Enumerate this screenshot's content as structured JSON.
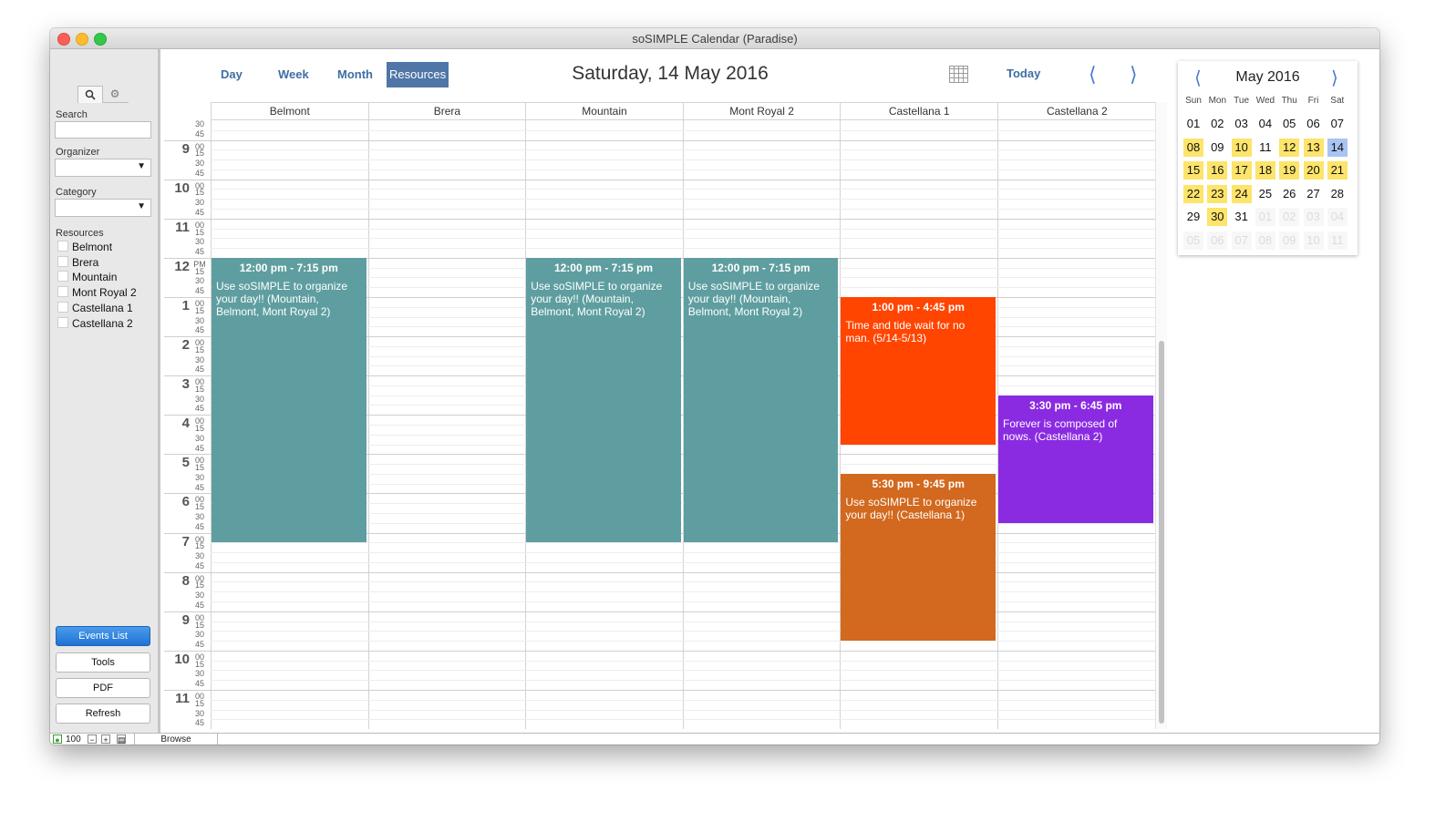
{
  "window": {
    "title": "soSIMPLE Calendar (Paradise)"
  },
  "sidebar": {
    "search_label": "Search",
    "organizer_label": "Organizer",
    "category_label": "Category",
    "resources_label": "Resources",
    "resources": [
      "Belmont",
      "Brera",
      "Mountain",
      "Mont Royal 2",
      "Castellana 1",
      "Castellana 2"
    ],
    "buttons": {
      "events_list": "Events List",
      "tools": "Tools",
      "pdf": "PDF",
      "refresh": "Refresh"
    }
  },
  "toolbar": {
    "tabs": {
      "day": "Day",
      "week": "Week",
      "month": "Month",
      "resources": "Resources"
    },
    "active_tab": "Resources",
    "date_title": "Saturday, 14 May 2016",
    "today_label": "Today",
    "prev_icon": "chevron-left-icon",
    "next_icon": "chevron-right-icon",
    "calendar_icon": "calendar-grid-icon"
  },
  "grid": {
    "columns": [
      "Belmont",
      "Brera",
      "Mountain",
      "Mont Royal 2",
      "Castellana 1",
      "Castellana 2"
    ],
    "hours": [
      {
        "label": "9",
        "sub": "00"
      },
      {
        "label": "10",
        "sub": "00"
      },
      {
        "label": "11",
        "sub": "00"
      },
      {
        "label": "12",
        "sub": "PM"
      },
      {
        "label": "1",
        "sub": "00"
      },
      {
        "label": "2",
        "sub": "00"
      },
      {
        "label": "3",
        "sub": "00"
      },
      {
        "label": "4",
        "sub": "00"
      },
      {
        "label": "5",
        "sub": "00"
      },
      {
        "label": "6",
        "sub": "00"
      },
      {
        "label": "7",
        "sub": "00"
      },
      {
        "label": "8",
        "sub": "00"
      },
      {
        "label": "9",
        "sub": "00"
      },
      {
        "label": "10",
        "sub": "00"
      },
      {
        "label": "11",
        "sub": "00"
      }
    ],
    "quarter_labels": [
      "15",
      "30",
      "45"
    ],
    "top_partial": [
      "30",
      "45"
    ]
  },
  "events": [
    {
      "column": 0,
      "start": 12.0,
      "end": 19.25,
      "time": "12:00 pm - 7:15 pm",
      "text": "Use soSIMPLE to organize your day!! (Mountain, Belmont, Mont Royal 2)",
      "color": "#5f9ea0"
    },
    {
      "column": 2,
      "start": 12.0,
      "end": 19.25,
      "time": "12:00 pm - 7:15 pm",
      "text": "Use soSIMPLE to organize your day!! (Mountain, Belmont, Mont Royal 2)",
      "color": "#5f9ea0"
    },
    {
      "column": 3,
      "start": 12.0,
      "end": 19.25,
      "time": "12:00 pm - 7:15 pm",
      "text": "Use soSIMPLE to organize your day!! (Mountain, Belmont, Mont Royal 2)",
      "color": "#5f9ea0"
    },
    {
      "column": 4,
      "start": 13.0,
      "end": 16.75,
      "time": "1:00 pm - 4:45 pm",
      "text": "Time and tide wait for no man. (5/14-5/13)",
      "color": "#ff4500"
    },
    {
      "column": 4,
      "start": 17.5,
      "end": 21.75,
      "time": "5:30 pm - 9:45 pm",
      "text": "Use soSIMPLE to organize your day!! (Castellana 1)",
      "color": "#d2691e"
    },
    {
      "column": 5,
      "start": 15.5,
      "end": 18.75,
      "time": "3:30 pm - 6:45 pm",
      "text": "Forever is composed of nows. (Castellana 2)",
      "color": "#8a2be2"
    }
  ],
  "mini_calendar": {
    "title": "May 2016",
    "weekdays": [
      "Sun",
      "Mon",
      "Tue",
      "Wed",
      "Thu",
      "Fri",
      "Sat"
    ],
    "weeks": [
      [
        {
          "d": "01"
        },
        {
          "d": "02"
        },
        {
          "d": "03"
        },
        {
          "d": "04"
        },
        {
          "d": "05"
        },
        {
          "d": "06"
        },
        {
          "d": "07"
        }
      ],
      [
        {
          "d": "08",
          "s": "hl"
        },
        {
          "d": "09"
        },
        {
          "d": "10",
          "s": "hl"
        },
        {
          "d": "11"
        },
        {
          "d": "12",
          "s": "hl"
        },
        {
          "d": "13",
          "s": "hl"
        },
        {
          "d": "14",
          "s": "sel"
        }
      ],
      [
        {
          "d": "15",
          "s": "hl"
        },
        {
          "d": "16",
          "s": "hl"
        },
        {
          "d": "17",
          "s": "hl"
        },
        {
          "d": "18",
          "s": "hl"
        },
        {
          "d": "19",
          "s": "hl"
        },
        {
          "d": "20",
          "s": "hl"
        },
        {
          "d": "21",
          "s": "hl"
        }
      ],
      [
        {
          "d": "22",
          "s": "hl"
        },
        {
          "d": "23",
          "s": "hl"
        },
        {
          "d": "24",
          "s": "hl"
        },
        {
          "d": "25"
        },
        {
          "d": "26"
        },
        {
          "d": "27"
        },
        {
          "d": "28"
        }
      ],
      [
        {
          "d": "29"
        },
        {
          "d": "30",
          "s": "hl"
        },
        {
          "d": "31"
        },
        {
          "d": "01",
          "s": "muted"
        },
        {
          "d": "02",
          "s": "muted"
        },
        {
          "d": "03",
          "s": "muted"
        },
        {
          "d": "04",
          "s": "muted"
        }
      ],
      [
        {
          "d": "05",
          "s": "muted"
        },
        {
          "d": "06",
          "s": "muted"
        },
        {
          "d": "07",
          "s": "muted"
        },
        {
          "d": "08",
          "s": "muted"
        },
        {
          "d": "09",
          "s": "muted"
        },
        {
          "d": "10",
          "s": "muted"
        },
        {
          "d": "11",
          "s": "muted"
        }
      ]
    ]
  },
  "status_bar": {
    "zoom": "100",
    "mode": "Browse"
  }
}
